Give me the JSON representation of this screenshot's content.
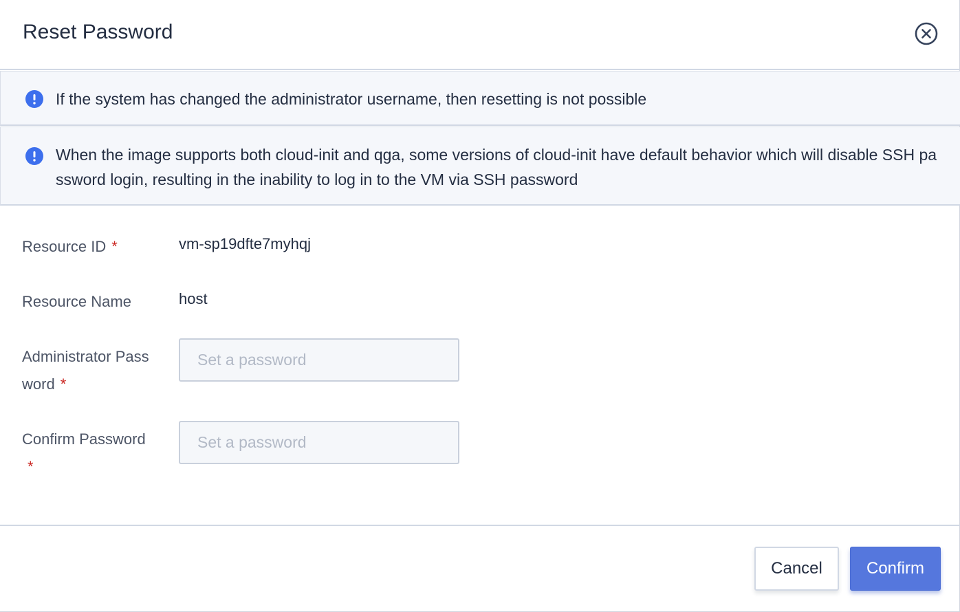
{
  "dialog": {
    "title": "Reset Password",
    "close_icon": "close-circle-icon"
  },
  "alerts": [
    {
      "icon": "info-circle-icon",
      "color": "#3d6fed",
      "text": "If the system has changed the administrator username, then resetting is not possible"
    },
    {
      "icon": "info-circle-icon",
      "color": "#3d6fed",
      "text": "When the image supports both cloud-init and qga, some versions of cloud-init have default behavior which will disable SSH password login, resulting in the inability to log in to the VM via SSH password"
    }
  ],
  "form": {
    "resource_id": {
      "label": "Resource ID",
      "required_mark": "*",
      "value": "vm-sp19dfte7myhqj"
    },
    "resource_name": {
      "label": "Resource Name",
      "value": "host"
    },
    "admin_password": {
      "label": "Administrator Password",
      "required_mark": "*",
      "placeholder": "Set a password",
      "value": ""
    },
    "confirm_password": {
      "label": "Confirm Password",
      "required_mark": "*",
      "placeholder": "Set a password",
      "value": ""
    }
  },
  "footer": {
    "cancel_label": "Cancel",
    "confirm_label": "Confirm"
  },
  "colors": {
    "accent": "#5577dd",
    "required": "#ca2621",
    "info": "#3d6fed"
  }
}
